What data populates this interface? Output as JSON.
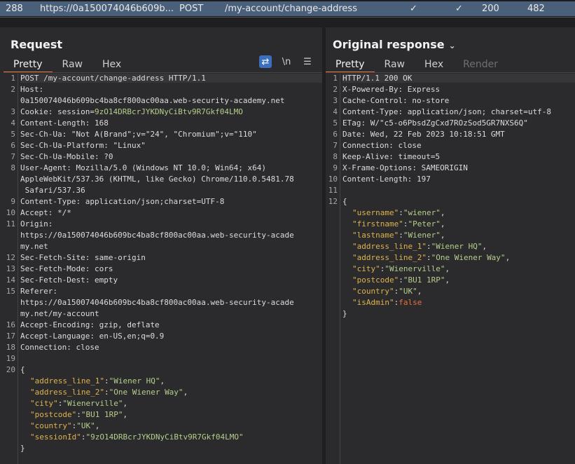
{
  "history": {
    "id": "288",
    "host": "https://0a150074046b609b...",
    "method": "POST",
    "url": "/my-account/change-address",
    "check1": "✓",
    "check2": "✓",
    "status": "200",
    "length": "482"
  },
  "request": {
    "title": "Request",
    "tabs": [
      "Pretty",
      "Raw",
      "Hex"
    ],
    "tools": {
      "wrap": "⇄",
      "newline": "\\n",
      "menu": "☰"
    },
    "gutter": [
      "1",
      "2",
      "",
      "3",
      "4",
      "5",
      "6",
      "7",
      "8",
      "",
      "",
      "9",
      "10",
      "11",
      "",
      "",
      "12",
      "13",
      "14",
      "15",
      "",
      "",
      "16",
      "17",
      "18",
      "19",
      "20",
      "",
      "",
      "",
      "",
      "",
      "",
      "",
      ""
    ],
    "lines": [
      {
        "k": "POST /my-account/change-address HTTP/1.1",
        "v": ""
      },
      {
        "k": "Host:",
        "v": ""
      },
      {
        "k": "",
        "v": "0a150074046b609bc4ba8cf800ac00aa.web-security-academy.net"
      },
      {
        "k": "Cookie:",
        "v": " session=",
        "c": "9zO14DRBcrJYKDNyCiBtv9R7Gkf04LMO"
      },
      {
        "k": "Content-Length:",
        "v": " 168"
      },
      {
        "k": "Sec-Ch-Ua:",
        "v": " \"Not A(Brand\";v=\"24\", \"Chromium\";v=\"110\""
      },
      {
        "k": "Sec-Ch-Ua-Platform:",
        "v": " \"Linux\""
      },
      {
        "k": "Sec-Ch-Ua-Mobile:",
        "v": " ?0"
      },
      {
        "k": "User-Agent:",
        "v": " Mozilla/5.0 (Windows NT 10.0; Win64; x64)"
      },
      {
        "k": "",
        "v": "AppleWebKit/537.36 (KHTML, like Gecko) Chrome/110.0.5481.78"
      },
      {
        "k": "",
        "v": " Safari/537.36"
      },
      {
        "k": "Content-Type:",
        "v": " application/json;charset=UTF-8"
      },
      {
        "k": "Accept:",
        "v": " */*"
      },
      {
        "k": "Origin:",
        "v": ""
      },
      {
        "k": "",
        "v": "https://0a150074046b609bc4ba8cf800ac00aa.web-security-acade"
      },
      {
        "k": "",
        "v": "my.net"
      },
      {
        "k": "Sec-Fetch-Site:",
        "v": " same-origin"
      },
      {
        "k": "Sec-Fetch-Mode:",
        "v": " cors"
      },
      {
        "k": "Sec-Fetch-Dest:",
        "v": " empty"
      },
      {
        "k": "Referer:",
        "v": ""
      },
      {
        "k": "",
        "v": "https://0a150074046b609bc4ba8cf800ac00aa.web-security-acade"
      },
      {
        "k": "",
        "v": "my.net/my-account"
      },
      {
        "k": "Accept-Encoding:",
        "v": " gzip, deflate"
      },
      {
        "k": "Accept-Language:",
        "v": " en-US,en;q=0.9"
      },
      {
        "k": "Connection:",
        "v": " close"
      },
      {
        "k": "",
        "v": ""
      },
      {
        "k": "{",
        "v": ""
      }
    ],
    "json": [
      {
        "key": "\"address_line_1\"",
        "val": "\"Wiener HQ\"",
        "end": ","
      },
      {
        "key": "\"address_line_2\"",
        "val": "\"One Wiener Way\"",
        "end": ","
      },
      {
        "key": "\"city\"",
        "val": "\"Wienerville\"",
        "end": ","
      },
      {
        "key": "\"postcode\"",
        "val": "\"BU1 1RP\"",
        "end": ","
      },
      {
        "key": "\"country\"",
        "val": "\"UK\"",
        "end": ","
      },
      {
        "key": "\"sessionId\"",
        "val": "\"9zO14DRBcrJYKDNyCiBtv9R7Gkf04LMO\"",
        "end": ""
      }
    ],
    "close": "}"
  },
  "response": {
    "title": "Original response",
    "chevron": "⌄",
    "tabs": [
      "Pretty",
      "Raw",
      "Hex",
      "Render"
    ],
    "gutter": [
      "1",
      "2",
      "3",
      "4",
      "5",
      "6",
      "7",
      "8",
      "9",
      "10",
      "11",
      "12"
    ],
    "lines": [
      {
        "k": "HTTP/1.1 200 OK",
        "v": ""
      },
      {
        "k": "X-Powered-By:",
        "v": " Express"
      },
      {
        "k": "Cache-Control:",
        "v": " no-store"
      },
      {
        "k": "Content-Type:",
        "v": " application/json; charset=utf-8"
      },
      {
        "k": "ETag:",
        "v": " W/\"c5-o6PbsdZgCxd7ROzSod5GR7NXS6Q\""
      },
      {
        "k": "Date:",
        "v": " Wed, 22 Feb 2023 10:18:51 GMT"
      },
      {
        "k": "Connection:",
        "v": " close"
      },
      {
        "k": "Keep-Alive:",
        "v": " timeout=5"
      },
      {
        "k": "X-Frame-Options:",
        "v": " SAMEORIGIN"
      },
      {
        "k": "Content-Length:",
        "v": " 197"
      },
      {
        "k": "",
        "v": ""
      },
      {
        "k": "{",
        "v": ""
      }
    ],
    "json": [
      {
        "key": "\"username\"",
        "val": "\"wiener\"",
        "end": ","
      },
      {
        "key": "\"firstname\"",
        "val": "\"Peter\"",
        "end": ","
      },
      {
        "key": "\"lastname\"",
        "val": "\"Wiener\"",
        "end": ","
      },
      {
        "key": "\"address_line_1\"",
        "val": "\"Wiener HQ\"",
        "end": ","
      },
      {
        "key": "\"address_line_2\"",
        "val": "\"One Wiener Way\"",
        "end": ","
      },
      {
        "key": "\"city\"",
        "val": "\"Wienerville\"",
        "end": ","
      },
      {
        "key": "\"postcode\"",
        "val": "\"BU1 1RP\"",
        "end": ","
      },
      {
        "key": "\"country\"",
        "val": "\"UK\"",
        "end": ","
      },
      {
        "key": "\"isAdmin\"",
        "val": "false",
        "end": "",
        "bool": true
      }
    ],
    "close": "}"
  }
}
